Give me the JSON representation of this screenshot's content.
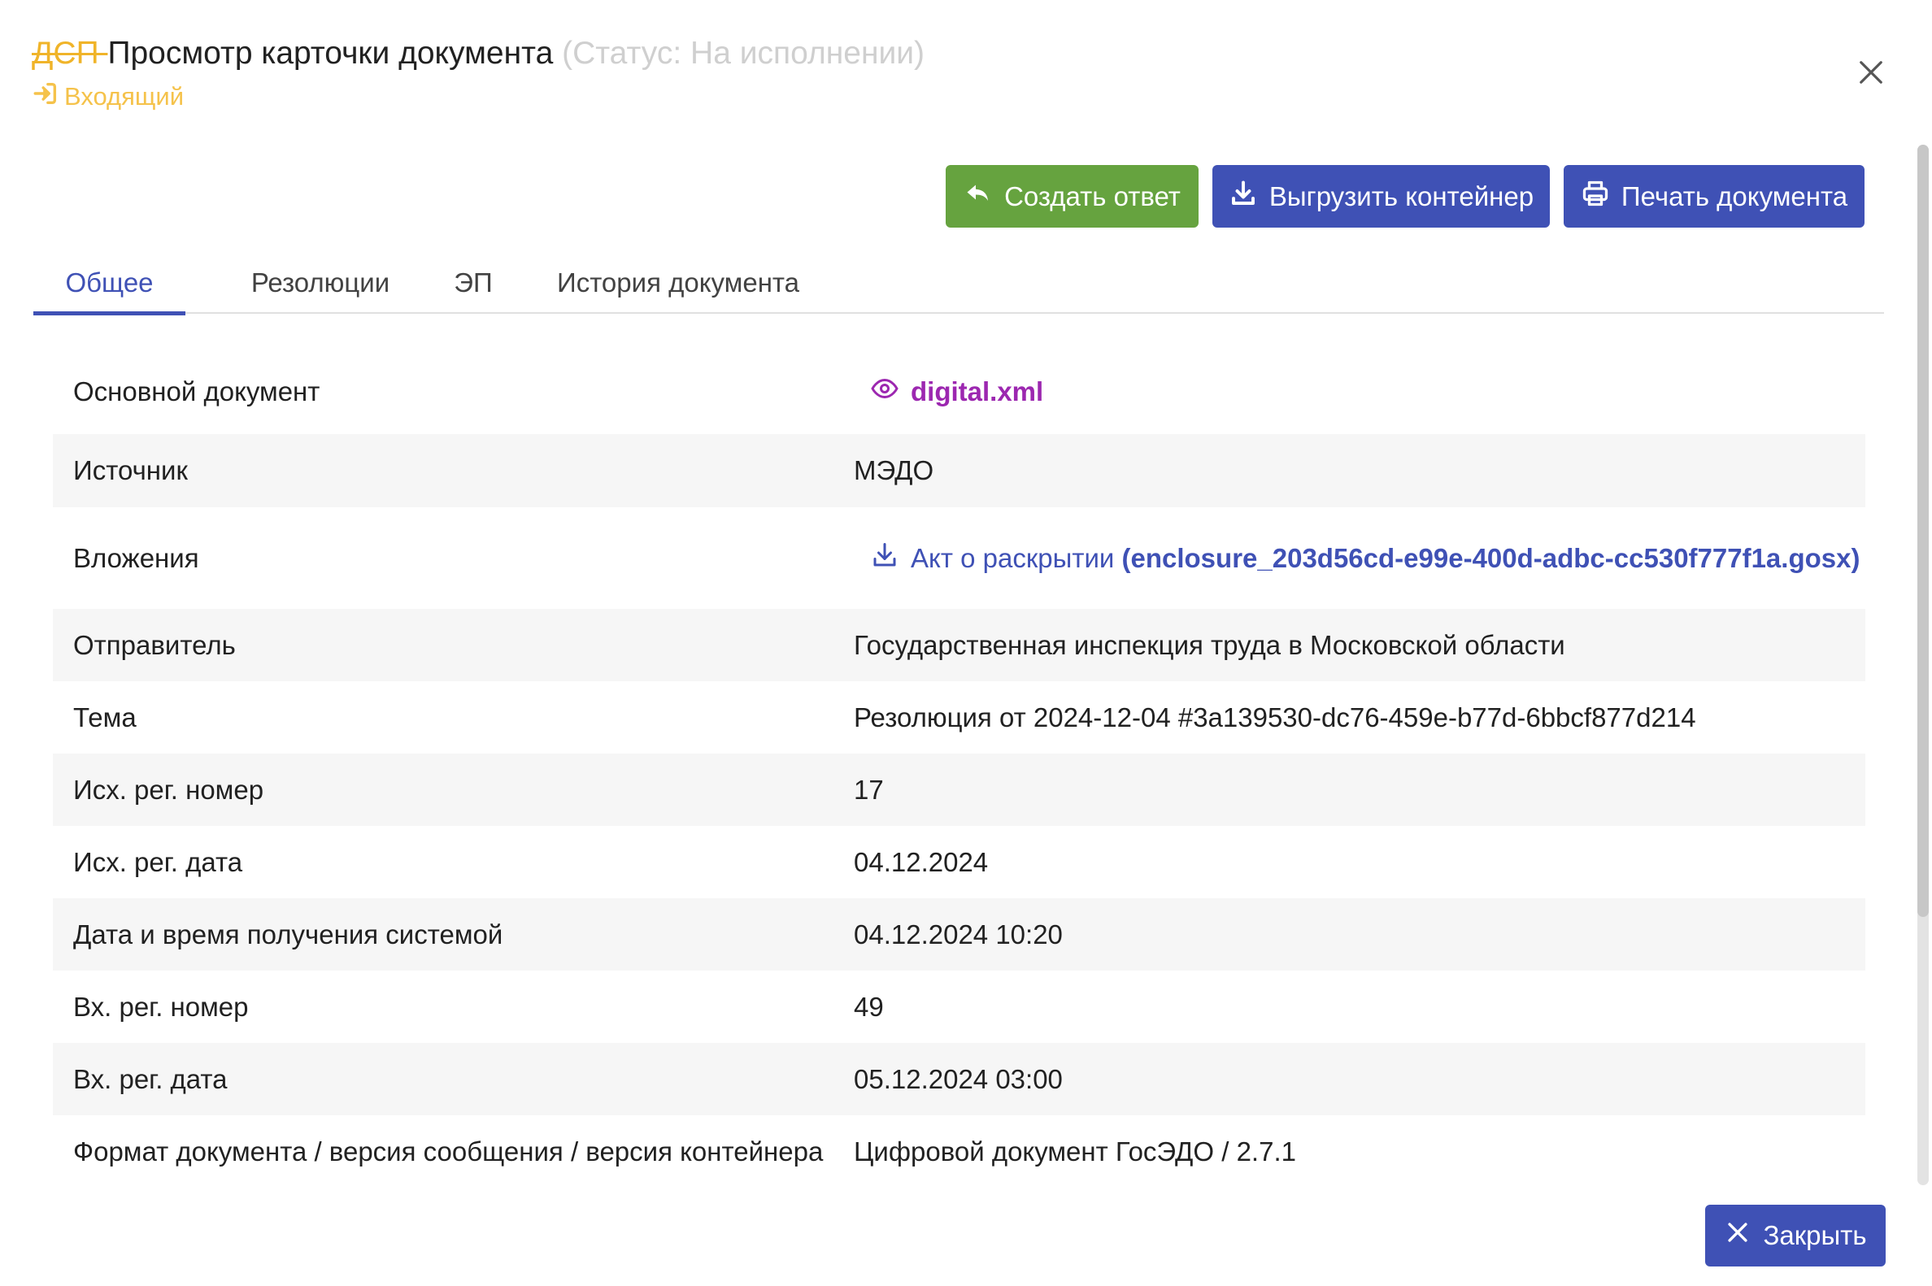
{
  "header": {
    "dsp": "ДСП ",
    "title": "Просмотр карточки документа",
    "status": " (Статус: На исполнении)",
    "doc_type": "Входящий"
  },
  "toolbar": {
    "reply_label": "Создать ответ",
    "export_label": "Выгрузить контейнер",
    "print_label": "Печать документа"
  },
  "tabs": [
    "Общее",
    "Резолюции",
    "ЭП",
    "История документа"
  ],
  "rows": [
    {
      "label": "Основной документ",
      "value": "digital.xml"
    },
    {
      "label": "Источник",
      "value": "МЭДО"
    },
    {
      "label": "Вложения",
      "value_prefix": "Акт о раскрытии ",
      "value": "(enclosure_203d56cd-e99e-400d-adbc-cc530f777f1a.gosx)"
    },
    {
      "label": "Отправитель",
      "value": "Государственная инспекция труда в Московской области"
    },
    {
      "label": "Тема",
      "value": "Резолюция от 2024-12-04 #3a139530-dc76-459e-b77d-6bbcf877d214"
    },
    {
      "label": "Исх. рег. номер",
      "value": "17"
    },
    {
      "label": "Исх. рег. дата",
      "value": "04.12.2024"
    },
    {
      "label": "Дата и время получения системой",
      "value": "04.12.2024 10:20"
    },
    {
      "label": "Вх. рег. номер",
      "value": "49"
    },
    {
      "label": "Вх. рег. дата",
      "value": "05.12.2024 03:00"
    },
    {
      "label": "Формат документа / версия сообщения / версия контейнера",
      "value": "Цифровой документ ГосЭДО / 2.7.1"
    }
  ],
  "footer": {
    "close_label": "Закрыть"
  },
  "colors": {
    "primary": "#3f51b5",
    "success": "#66a33f",
    "dsp": "#f0b429",
    "link_purple": "#9c27b0"
  }
}
